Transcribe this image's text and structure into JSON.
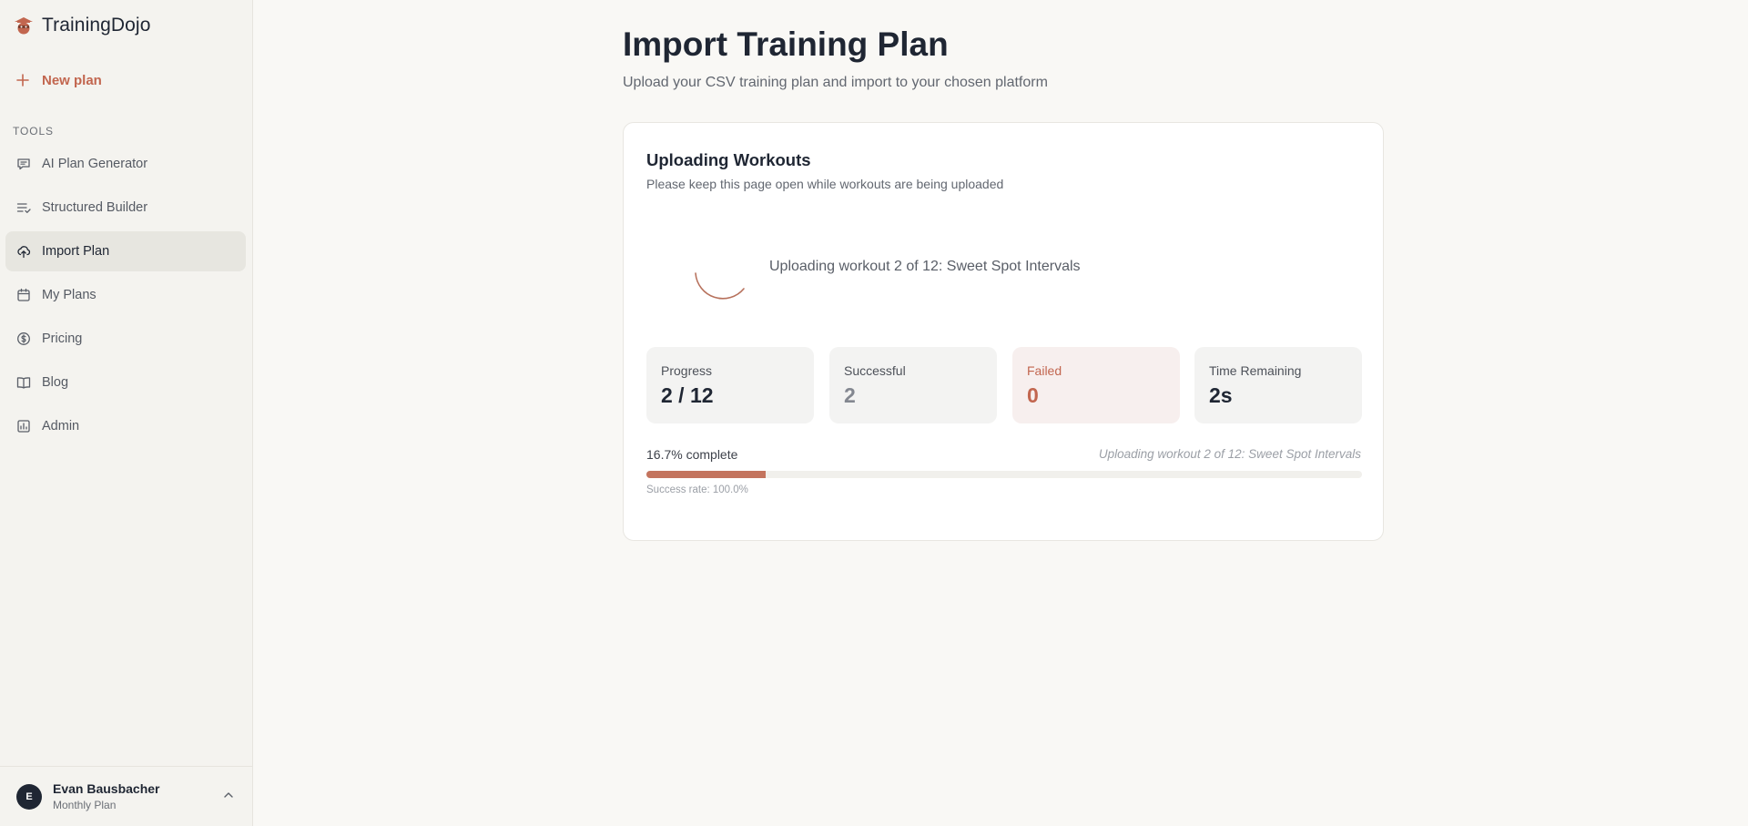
{
  "app": {
    "name": "TrainingDojo"
  },
  "colors": {
    "accent": "#c2664f",
    "bar": "#c4745e",
    "active_nav_bg": "#e7e6e0"
  },
  "sidebar": {
    "new_plan_label": "New plan",
    "section_label": "TOOLS",
    "items": [
      {
        "label": "AI Plan Generator",
        "icon": "chat-bubble-icon"
      },
      {
        "label": "Structured Builder",
        "icon": "list-check-icon"
      },
      {
        "label": "Import Plan",
        "icon": "cloud-upload-icon",
        "active": true
      },
      {
        "label": "My Plans",
        "icon": "calendar-icon"
      },
      {
        "label": "Pricing",
        "icon": "dollar-circle-icon"
      },
      {
        "label": "Blog",
        "icon": "book-open-icon"
      },
      {
        "label": "Admin",
        "icon": "admin-chart-icon"
      }
    ],
    "user": {
      "initial": "E",
      "name": "Evan Bausbacher",
      "plan": "Monthly Plan"
    }
  },
  "main": {
    "title": "Import Training Plan",
    "subtitle": "Upload your CSV training plan and import to your chosen platform",
    "card": {
      "title": "Uploading Workouts",
      "subtitle": "Please keep this page open while workouts are being uploaded",
      "status": "Uploading workout 2 of 12: Sweet Spot Intervals",
      "stats": {
        "progress": {
          "label": "Progress",
          "value": "2 / 12"
        },
        "successful": {
          "label": "Successful",
          "value": "2"
        },
        "failed": {
          "label": "Failed",
          "value": "0"
        },
        "time_remaining": {
          "label": "Time Remaining",
          "value": "2s"
        }
      },
      "percent_text": "16.7% complete",
      "percent": 16.7,
      "current_text": "Uploading workout 2 of 12: Sweet Spot Intervals",
      "success_rate": "Success rate: 100.0%"
    }
  }
}
